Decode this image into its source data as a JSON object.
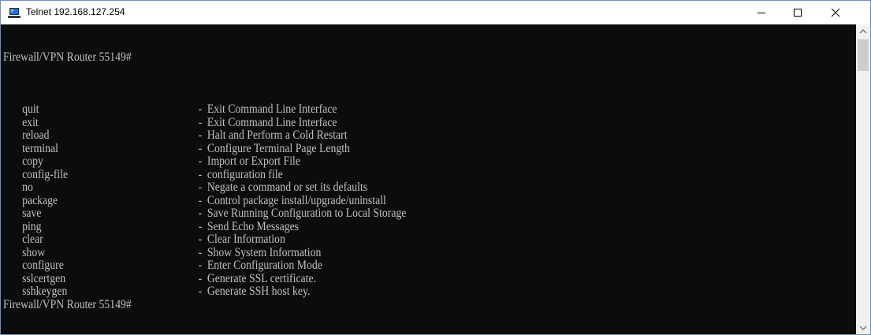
{
  "window": {
    "title": "Telnet 192.168.127.254",
    "minimize_icon": "minimize-icon",
    "maximize_icon": "maximize-icon",
    "close_icon": "close-icon"
  },
  "terminal": {
    "prompt": "Firewall/VPN Router 55149#",
    "commands": [
      {
        "cmd": "quit",
        "desc": "Exit Command Line Interface"
      },
      {
        "cmd": "exit",
        "desc": "Exit Command Line Interface"
      },
      {
        "cmd": "reload",
        "desc": "Halt and Perform a Cold Restart"
      },
      {
        "cmd": "terminal",
        "desc": "Configure Terminal Page Length"
      },
      {
        "cmd": "copy",
        "desc": "Import or Export File"
      },
      {
        "cmd": "config-file",
        "desc": "configuration file"
      },
      {
        "cmd": "no",
        "desc": "Negate a command or set its defaults"
      },
      {
        "cmd": "package",
        "desc": "Control package install/upgrade/uninstall"
      },
      {
        "cmd": "save",
        "desc": "Save Running Configuration to Local Storage"
      },
      {
        "cmd": "ping",
        "desc": "Send Echo Messages"
      },
      {
        "cmd": "clear",
        "desc": "Clear Information"
      },
      {
        "cmd": "show",
        "desc": "Show System Information"
      },
      {
        "cmd": "configure",
        "desc": "Enter Configuration Mode"
      },
      {
        "cmd": "sslcertgen",
        "desc": "Generate SSL certificate."
      },
      {
        "cmd": "sshkeygen",
        "desc": "Generate SSH host key."
      }
    ],
    "separator": "-",
    "final_prompt": "Firewall/VPN Router 55149#"
  },
  "colors": {
    "terminal_bg": "#0c0c0c",
    "terminal_fg": "#c0c0c0"
  }
}
